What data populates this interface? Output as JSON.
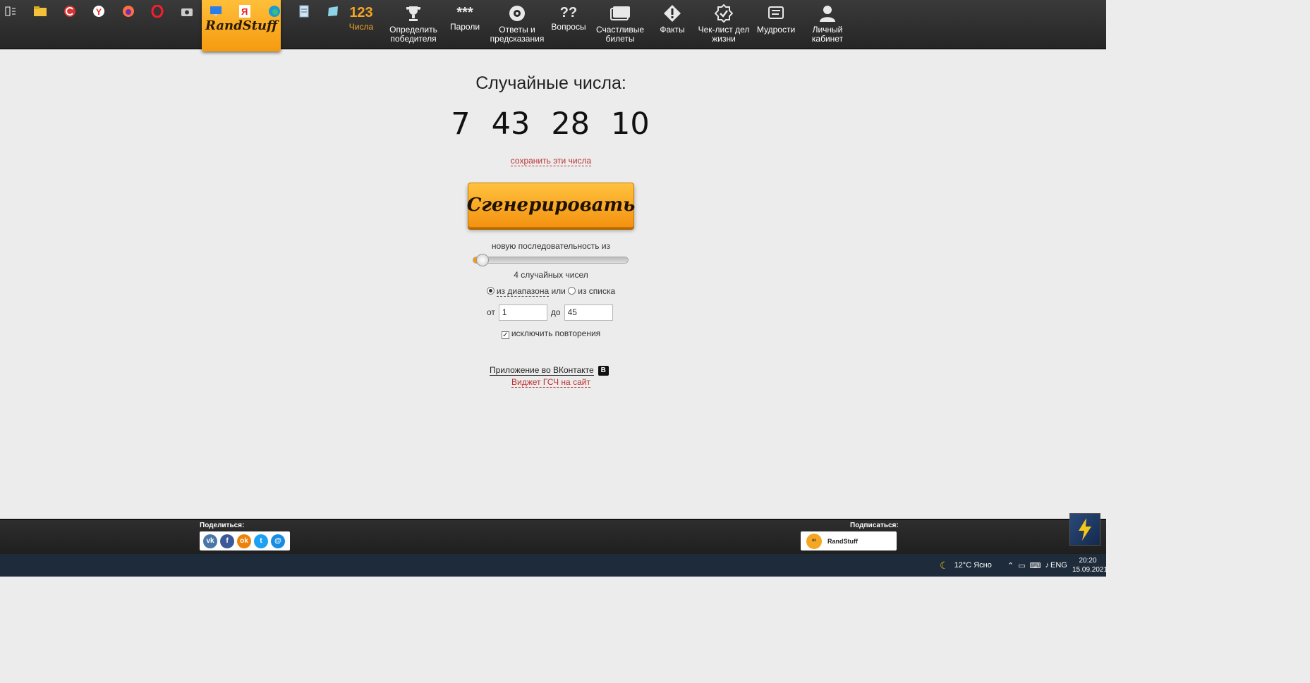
{
  "brand": {
    "logo_text": "RandStuff",
    "accent": "#f5a623"
  },
  "nav": {
    "items": [
      {
        "label": "Числа",
        "icon": "numbers-123-icon",
        "glyph": "123",
        "active": true
      },
      {
        "label": "Определить победителя",
        "icon": "trophy-icon"
      },
      {
        "label": "Пароли",
        "icon": "password-asterisks-icon",
        "glyph": "***"
      },
      {
        "label": "Ответы и предсказания",
        "icon": "magic-8-ball-icon"
      },
      {
        "label": "Вопросы",
        "icon": "question-marks-icon",
        "glyph": "??"
      },
      {
        "label": "Счастливые билеты",
        "icon": "tickets-icon"
      },
      {
        "label": "Факты",
        "icon": "exclamation-icon"
      },
      {
        "label": "Чек-лист дел жизни",
        "icon": "checkmark-badge-icon"
      },
      {
        "label": "Мудрости",
        "icon": "scroll-icon"
      },
      {
        "label": "Личный кабинет",
        "icon": "user-icon"
      }
    ]
  },
  "main": {
    "title": "Случайные числа:",
    "numbers": [
      "7",
      "43",
      "28",
      "10"
    ],
    "save_link": "сохранить эти числа",
    "generate_button": "Сгенерировать",
    "sequence_label": "новую последовательность из",
    "slider_fraction": 0.06,
    "count_label": "4 случайных чисел",
    "mode": {
      "range_label": "из диапазона",
      "or_label": "или",
      "list_label": "из списка",
      "selected": "range"
    },
    "range": {
      "from_label": "от",
      "from_value": "1",
      "to_label": "до",
      "to_value": "45"
    },
    "exclude_repeats": {
      "label": "исключить повторения",
      "checked": true
    },
    "vk_app_link": "Приложение во ВКонтакте",
    "vk_badge": "B",
    "widget_link": "Виджет ГСЧ на сайт"
  },
  "footer": {
    "share_label": "Поделиться:",
    "share_buttons": [
      {
        "icon": "vk-icon",
        "glyph": "vk",
        "color": "#4a76a8"
      },
      {
        "icon": "facebook-icon",
        "glyph": "f",
        "color": "#3b5998"
      },
      {
        "icon": "odnoklassniki-icon",
        "glyph": "ok",
        "color": "#ee8208"
      },
      {
        "icon": "twitter-icon",
        "glyph": "t",
        "color": "#1da1f2"
      },
      {
        "icon": "mail-agent-icon",
        "glyph": "@",
        "color": "#168de2"
      }
    ],
    "subscribe_label": "Подписаться:",
    "subscribe_name": "RandStuff"
  },
  "taskbar": {
    "weather": "12°C Ясно",
    "language": "ENG",
    "time": "20:20",
    "date": "15.09.2021"
  }
}
